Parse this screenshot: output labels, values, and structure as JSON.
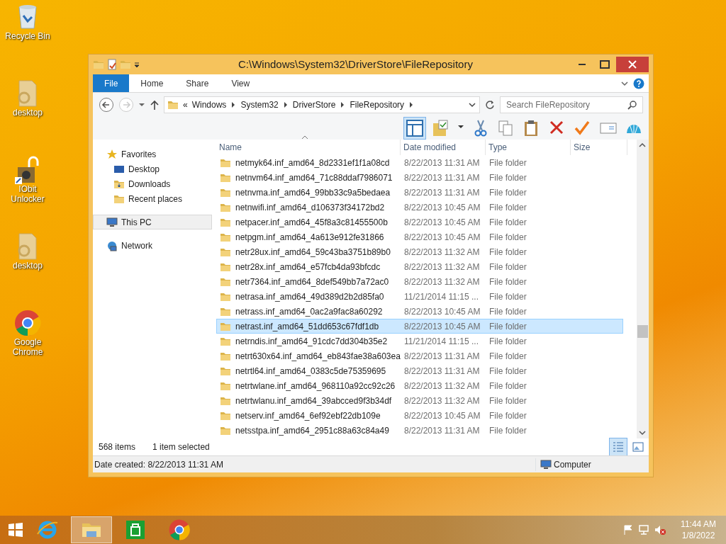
{
  "desktop_icons": [
    {
      "label": "Recycle Bin",
      "kind": "recycle"
    },
    {
      "label": "desktop",
      "kind": "file"
    },
    {
      "label": "IObit Unlocker",
      "kind": "unlocker"
    },
    {
      "label": "desktop",
      "kind": "file"
    },
    {
      "label": "Google Chrome",
      "kind": "chrome"
    }
  ],
  "window": {
    "title": "C:\\Windows\\System32\\DriverStore\\FileRepository"
  },
  "ribbon": {
    "tabs": [
      {
        "label": "File",
        "selected": true
      },
      {
        "label": "Home",
        "selected": false
      },
      {
        "label": "Share",
        "selected": false
      },
      {
        "label": "View",
        "selected": false
      }
    ]
  },
  "address": {
    "overflow": "«",
    "crumbs": [
      "Windows",
      "System32",
      "DriverStore",
      "FileRepository"
    ]
  },
  "search": {
    "placeholder": "Search FileRepository"
  },
  "nav": {
    "items": [
      {
        "label": "Favorites",
        "kind": "favorites",
        "selected": false,
        "children": [
          {
            "label": "Desktop",
            "kind": "desktop",
            "selected": false
          },
          {
            "label": "Downloads",
            "kind": "downloads",
            "selected": false
          },
          {
            "label": "Recent places",
            "kind": "recent",
            "selected": false
          }
        ]
      },
      {
        "label": "This PC",
        "kind": "pc",
        "selected": true
      },
      {
        "label": "Network",
        "kind": "network",
        "selected": false
      }
    ]
  },
  "table": {
    "columns": [
      "Name",
      "Date modified",
      "Type",
      "Size"
    ],
    "rows": [
      {
        "name": "netmyk64.inf_amd64_8d2331ef1f1a08cd",
        "date": "8/22/2013 11:31 AM",
        "type": "File folder",
        "selected": false
      },
      {
        "name": "netnvm64.inf_amd64_71c88ddaf7986071",
        "date": "8/22/2013 11:31 AM",
        "type": "File folder",
        "selected": false
      },
      {
        "name": "netnvma.inf_amd64_99bb33c9a5bedaea",
        "date": "8/22/2013 11:31 AM",
        "type": "File folder",
        "selected": false
      },
      {
        "name": "netnwifi.inf_amd64_d106373f34172bd2",
        "date": "8/22/2013 10:45 AM",
        "type": "File folder",
        "selected": false
      },
      {
        "name": "netpacer.inf_amd64_45f8a3c81455500b",
        "date": "8/22/2013 10:45 AM",
        "type": "File folder",
        "selected": false
      },
      {
        "name": "netpgm.inf_amd64_4a613e912fe31866",
        "date": "8/22/2013 10:45 AM",
        "type": "File folder",
        "selected": false
      },
      {
        "name": "netr28ux.inf_amd64_59c43ba3751b89b0",
        "date": "8/22/2013 11:32 AM",
        "type": "File folder",
        "selected": false
      },
      {
        "name": "netr28x.inf_amd64_e57fcb4da93bfcdc",
        "date": "8/22/2013 11:32 AM",
        "type": "File folder",
        "selected": false
      },
      {
        "name": "netr7364.inf_amd64_8def549bb7a72ac0",
        "date": "8/22/2013 11:32 AM",
        "type": "File folder",
        "selected": false
      },
      {
        "name": "netrasa.inf_amd64_49d389d2b2d85fa0",
        "date": "11/21/2014 11:15 ...",
        "type": "File folder",
        "selected": false
      },
      {
        "name": "netrass.inf_amd64_0ac2a9fac8a60292",
        "date": "8/22/2013 10:45 AM",
        "type": "File folder",
        "selected": false
      },
      {
        "name": "netrast.inf_amd64_51dd653c67fdf1db",
        "date": "8/22/2013 10:45 AM",
        "type": "File folder",
        "selected": true
      },
      {
        "name": "netrndis.inf_amd64_91cdc7dd304b35e2",
        "date": "11/21/2014 11:15 ...",
        "type": "File folder",
        "selected": false
      },
      {
        "name": "netrt630x64.inf_amd64_eb843fae38a603ea",
        "date": "8/22/2013 11:31 AM",
        "type": "File folder",
        "selected": false
      },
      {
        "name": "netrtl64.inf_amd64_0383c5de75359695",
        "date": "8/22/2013 11:31 AM",
        "type": "File folder",
        "selected": false
      },
      {
        "name": "netrtwlane.inf_amd64_968110a92cc92c26",
        "date": "8/22/2013 11:32 AM",
        "type": "File folder",
        "selected": false
      },
      {
        "name": "netrtwlanu.inf_amd64_39abcced9f3b34df",
        "date": "8/22/2013 11:32 AM",
        "type": "File folder",
        "selected": false
      },
      {
        "name": "netserv.inf_amd64_6ef92ebf22db109e",
        "date": "8/22/2013 10:45 AM",
        "type": "File folder",
        "selected": false
      },
      {
        "name": "netsstpa.inf_amd64_2951c88a63c84a49",
        "date": "8/22/2013 11:31 AM",
        "type": "File folder",
        "selected": false
      }
    ]
  },
  "status_bar": {
    "count": "568 items",
    "selection": "1 item selected",
    "views": [
      {
        "kind": "details",
        "selected": true
      },
      {
        "kind": "tiles",
        "selected": false
      }
    ]
  },
  "details_bar": {
    "text": "Date created: 8/22/2013 11:31 AM",
    "location": "Computer"
  },
  "taskbar": {
    "apps": [
      {
        "kind": "ie",
        "selected": false
      },
      {
        "kind": "explorer",
        "selected": true
      },
      {
        "kind": "store",
        "selected": false
      },
      {
        "kind": "chrome",
        "selected": false
      }
    ],
    "time": "11:44 AM",
    "date": "1/8/2022"
  }
}
